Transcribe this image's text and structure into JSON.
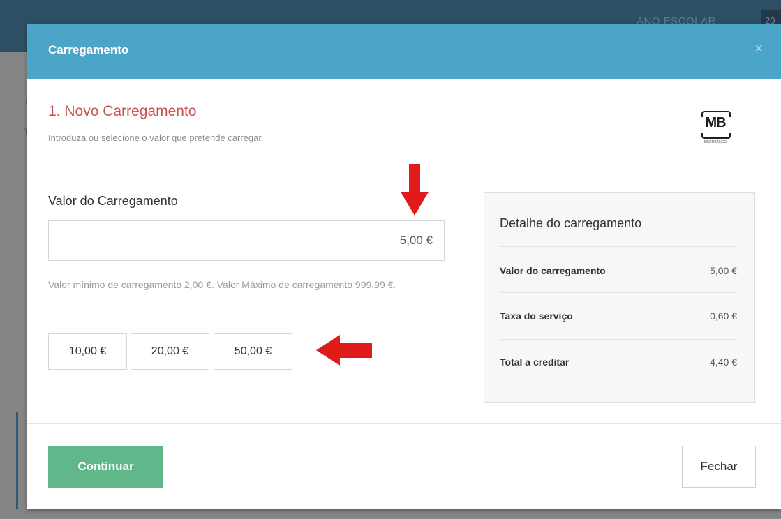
{
  "background": {
    "header_label": "ANO ESCOLAR",
    "header_year": "20",
    "page_letter": "C",
    "page_sub": "Ti"
  },
  "modal": {
    "title": "Carregamento",
    "close_symbol": "×",
    "step_title": "1. Novo Carregamento",
    "step_description": "Introduza ou selecione o valor que pretende carregar.",
    "logo": {
      "text": "MB",
      "caption": "MULTIBANCO",
      "icon": "multibanco-logo"
    },
    "amount": {
      "label": "Valor do Carregamento",
      "value": "5,00 €",
      "hint": "Valor mínimo de carregamento 2,00 €. Valor Máximo de carregamento 999,99 €."
    },
    "quick_amounts": [
      "10,00 €",
      "20,00 €",
      "50,00 €"
    ],
    "details": {
      "title": "Detalhe do carregamento",
      "rows": [
        {
          "label": "Valor do carregamento",
          "value": "5,00 €"
        },
        {
          "label": "Taxa do serviço",
          "value": "0,60 €"
        },
        {
          "label": "Total a creditar",
          "value": "4,40 €"
        }
      ]
    },
    "footer": {
      "continue_label": "Continuar",
      "close_label": "Fechar"
    }
  },
  "colors": {
    "header": "#4aa5c9",
    "step_title": "#c9514e",
    "continue": "#5fb78a",
    "annotation_arrow": "#e01b1b"
  }
}
